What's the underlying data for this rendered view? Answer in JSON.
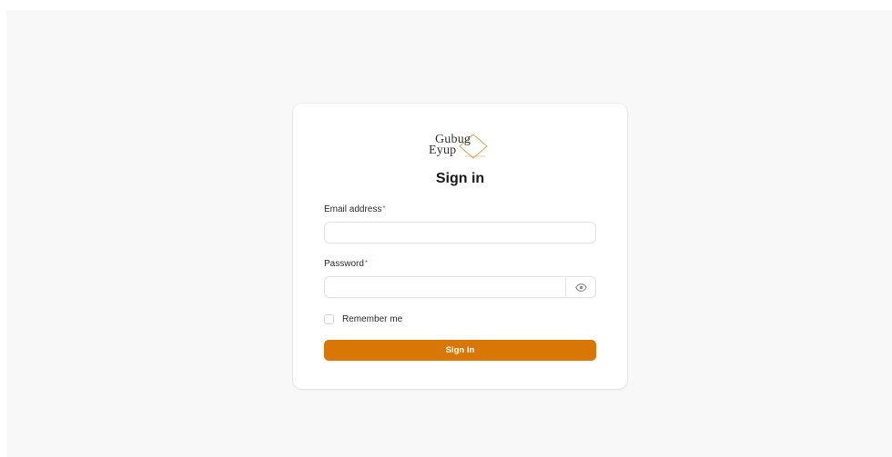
{
  "brand": {
    "logo_line1": "Gubug",
    "logo_line2": "Eyup"
  },
  "form": {
    "title": "Sign in",
    "email": {
      "label": "Email address",
      "required_mark": "*",
      "value": "",
      "placeholder": ""
    },
    "password": {
      "label": "Password",
      "required_mark": "*",
      "value": "",
      "placeholder": "",
      "toggle_icon": "eye-icon"
    },
    "remember": {
      "label": "Remember me",
      "checked": false
    },
    "submit_label": "Sign in"
  },
  "colors": {
    "accent": "#d97706",
    "required": "#e5484d",
    "background": "#f8f8f8",
    "card": "#ffffff"
  }
}
